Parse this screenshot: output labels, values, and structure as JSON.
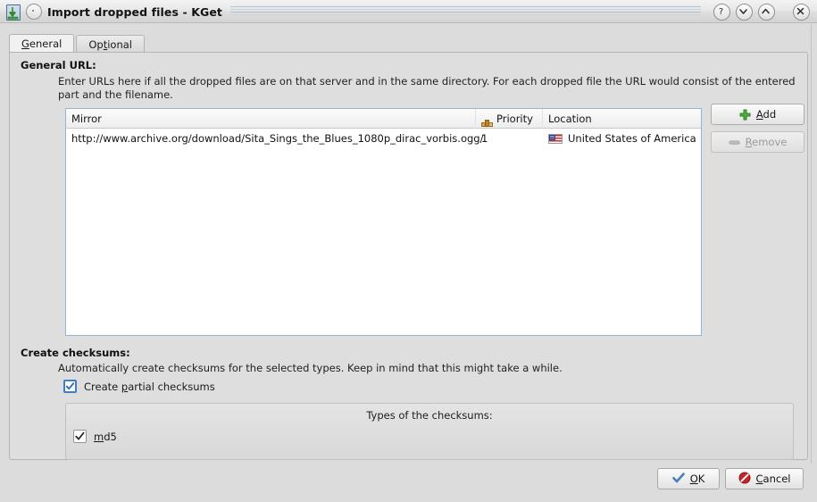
{
  "window": {
    "title": "Import dropped files - KGet",
    "app_icon": "download-arrow-icon",
    "pin_button": "sticky-window-button",
    "controls": [
      {
        "name": "help-button",
        "glyph": "?"
      },
      {
        "name": "shade-down-button",
        "glyph": "⌄"
      },
      {
        "name": "shade-up-button",
        "glyph": "⌃"
      },
      {
        "name": "close-button",
        "glyph": "✕"
      }
    ]
  },
  "tabs": [
    {
      "label": "General",
      "accel": "G",
      "active": true
    },
    {
      "label": "Optional",
      "accel": "t",
      "active": false
    }
  ],
  "general": {
    "url_section_title": "General URL:",
    "url_section_desc": "Enter URLs here if all the dropped files are on that server and in the same directory. For each dropped file the URL would consist of the entered part and the filename.",
    "table": {
      "columns": [
        "Mirror",
        "Priority",
        "Location"
      ],
      "priority_icon": "priority-bars-icon",
      "rows": [
        {
          "mirror": "http://www.archive.org/download/Sita_Sings_the_Blues_1080p_dirac_vorbis.ogg/",
          "priority": "1",
          "location": "United States of America",
          "location_icon": "flag-us-icon"
        }
      ]
    },
    "add_button": {
      "label": "Add",
      "accel": "A",
      "icon": "plus-icon",
      "enabled": true
    },
    "remove_button": {
      "label": "Remove",
      "accel": "R",
      "icon": "minus-icon",
      "enabled": false
    }
  },
  "checksums": {
    "section_title": "Create checksums:",
    "section_desc": "Automatically create checksums for the selected types. Keep in mind that this might take a while.",
    "partial": {
      "label_before": "Create ",
      "label_accel": "p",
      "label_after": "artial checksums",
      "checked": true
    },
    "types_caption": "Types of the checksums:",
    "types": [
      {
        "label_accel": "m",
        "label_after": "d5",
        "checked": true
      }
    ]
  },
  "dialog_buttons": {
    "ok": {
      "label_accel": "O",
      "label_after": "K",
      "icon": "check-icon"
    },
    "cancel": {
      "label_accel": "C",
      "label_after": "ancel",
      "icon": "cancel-icon"
    }
  },
  "colors": {
    "accent_blue": "#3c7fc4",
    "ok_check": "#4a7fb5",
    "cancel_red": "#c6232a",
    "add_green": "#4caf3f",
    "table_border": "#94b5d6",
    "window_bg": "#dcdcdc"
  }
}
